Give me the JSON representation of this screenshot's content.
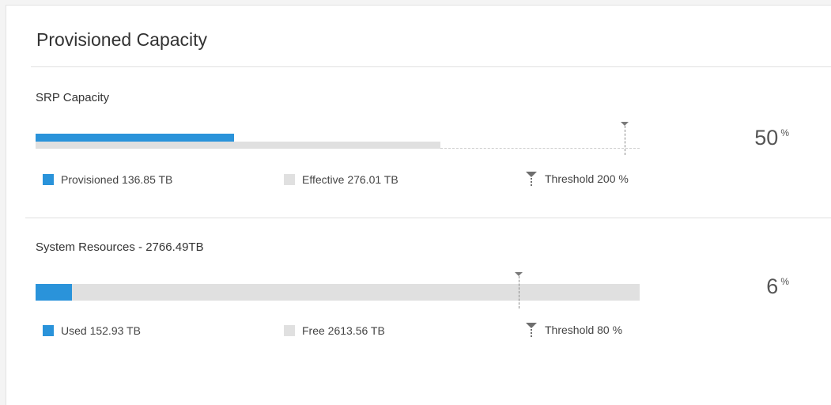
{
  "card": {
    "title": "Provisioned Capacity"
  },
  "srp": {
    "title": "SRP Capacity",
    "provisioned_fraction": 0.329,
    "effective_fraction": 0.67,
    "threshold_fraction": 0.975,
    "percent_value": "50",
    "percent_unit": "%",
    "legend": {
      "provisioned": "Provisioned 136.85 TB",
      "effective": "Effective 276.01 TB",
      "threshold": "Threshold 200 %"
    }
  },
  "system": {
    "title": "System Resources - 2766.49TB",
    "used_fraction": 0.06,
    "threshold_fraction": 0.8,
    "percent_value": "6",
    "percent_unit": "%",
    "legend": {
      "used": "Used 152.93 TB",
      "free": "Free 2613.56 TB",
      "threshold": "Threshold 80 %"
    }
  },
  "colors": {
    "accent": "#2a93da",
    "track": "#e0e0e0"
  }
}
